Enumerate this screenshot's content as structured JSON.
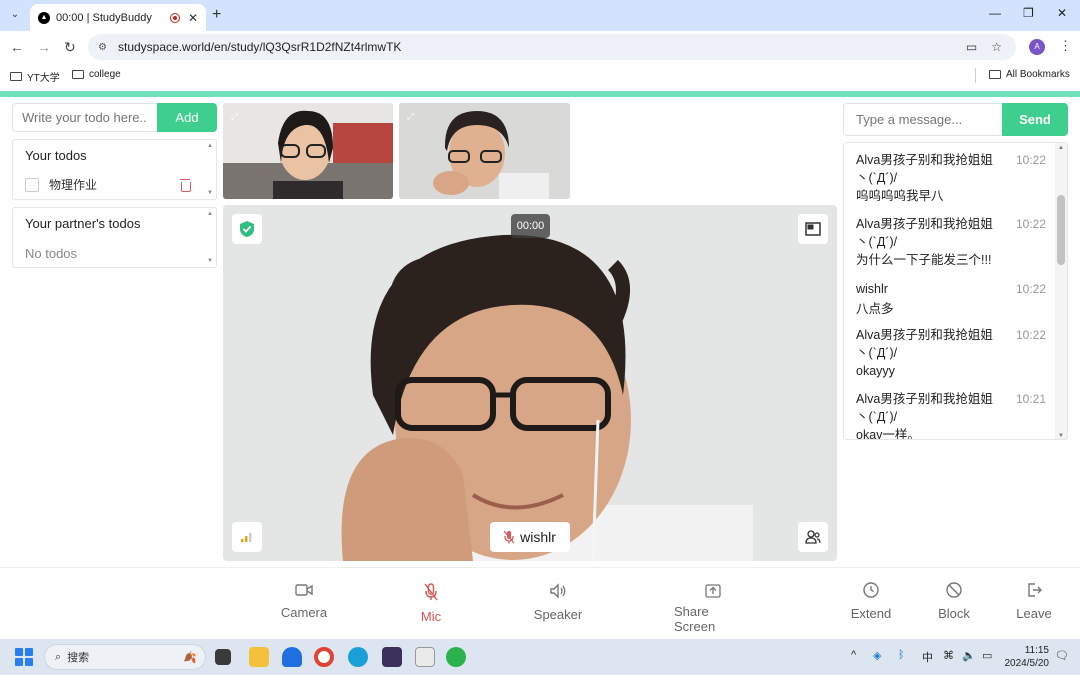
{
  "browser": {
    "tab_title": "00:00 | StudyBuddy",
    "url": "studyspace.world/en/study/lQ3QsrR1D2fNZt4rlmwTK",
    "profile_initial": "A",
    "bookmarks": [
      "YT大学",
      "college"
    ],
    "all_bookmarks": "All Bookmarks"
  },
  "todos": {
    "input_placeholder": "Write your todo here..",
    "add_label": "Add",
    "your_title": "Your todos",
    "items": [
      {
        "text": "物理作业",
        "checked": false
      }
    ],
    "partner_title": "Your partner's todos",
    "partner_empty": "No todos"
  },
  "video": {
    "timer": "00:00",
    "participant_name": "wishlr",
    "mic_muted": true
  },
  "chat": {
    "input_placeholder": "Type a message...",
    "send_label": "Send",
    "messages": [
      {
        "sender": "Alva男孩子别和我抢姐姐丶(`Д´)/",
        "time": "10:22",
        "text": "呜呜呜呜我早八"
      },
      {
        "sender": "Alva男孩子别和我抢姐姐丶(`Д´)/",
        "time": "10:22",
        "text": "为什么一下子能发三个!!!"
      },
      {
        "sender": "wishlr",
        "time": "10:22",
        "text": "八点多"
      },
      {
        "sender": "Alva男孩子别和我抢姐姐丶(`Д´)/",
        "time": "10:22",
        "text": "okayyy"
      },
      {
        "sender": "Alva男孩子别和我抢姐姐丶(`Д´)/",
        "time": "10:21",
        "text": "okay一样。"
      }
    ]
  },
  "controls": {
    "camera": "Camera",
    "mic": "Mic",
    "speaker": "Speaker",
    "share_screen": "Share Screen",
    "extend": "Extend",
    "block": "Block",
    "leave": "Leave"
  },
  "taskbar": {
    "search_label": "搜索",
    "ime": "中",
    "time": "11:15",
    "date": "2024/5/20"
  },
  "colors": {
    "accent_green": "#3ecf8e",
    "accent_line": "#6fe0b8",
    "mic_active_red": "#d9534f"
  }
}
